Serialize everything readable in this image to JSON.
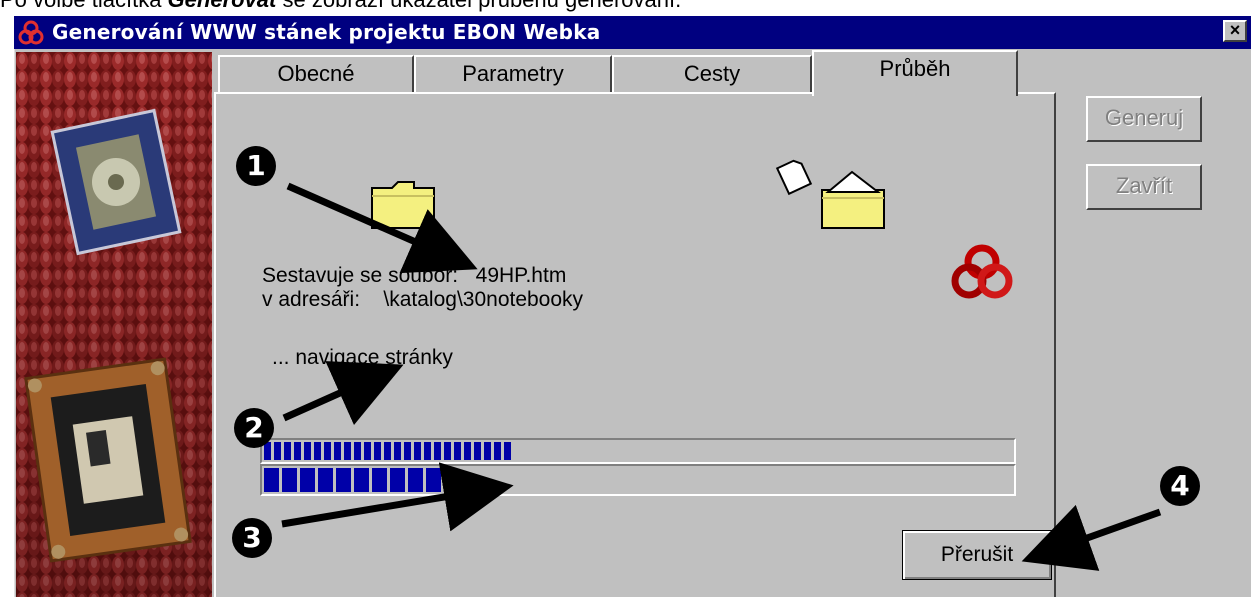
{
  "caption": {
    "prefix": "Po volbě tlačítka ",
    "bold": "Generovat",
    "suffix": " se zobrazí ukazatel průběhu generování."
  },
  "window": {
    "title": "Generování WWW stánek projektu EBON Webka",
    "close_label": "×",
    "icon": "ebon-knot-icon"
  },
  "tabs": [
    {
      "label": "Obecné",
      "active": false
    },
    {
      "label": "Parametry",
      "active": false
    },
    {
      "label": "Cesty",
      "active": false
    },
    {
      "label": "Průběh",
      "active": true
    }
  ],
  "buttons": {
    "generate": "Generuj",
    "close": "Zavřít",
    "abort": "Přerušit"
  },
  "status": {
    "file_label": "Sestavuje se soubor:",
    "file_value": "49HP.htm",
    "dir_label": "v adresáři:",
    "dir_value": "\\katalog\\30notebooky",
    "step": "... navigace stránky"
  },
  "progress": {
    "overall_fraction": 0.33,
    "current_fraction": 0.24,
    "bar_color": "#0000a8"
  },
  "callouts": [
    "1",
    "2",
    "3",
    "4"
  ],
  "colors": {
    "titlebar": "#000080",
    "face": "#c0c0c0",
    "logo_red": "#c00000"
  },
  "icons": [
    "ebon-knot-icon",
    "folder-icon",
    "document-icon",
    "open-folder-icon",
    "disk-art",
    "floppy-art"
  ]
}
